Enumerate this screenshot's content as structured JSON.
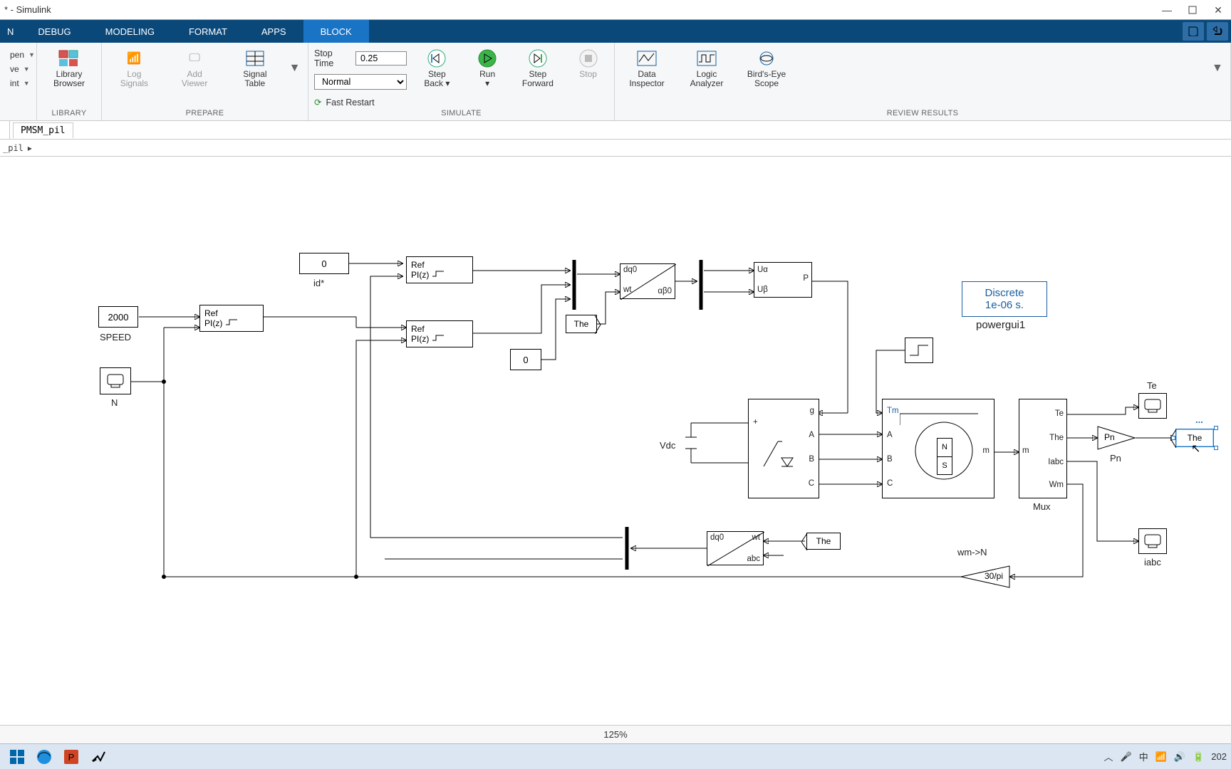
{
  "window": {
    "title": "* - Simulink",
    "min": "—",
    "max": "",
    "close": ""
  },
  "tabs": {
    "n": "N",
    "debug": "DEBUG",
    "modeling": "MODELING",
    "format": "FORMAT",
    "apps": "APPS",
    "block": "BLOCK"
  },
  "ribbon": {
    "file": {
      "open": "pen",
      "save": "ve",
      "print": "int"
    },
    "library": {
      "btn1": "Library",
      "btn2": "Browser",
      "group": "LIBRARY"
    },
    "prepare": {
      "log": "Log",
      "logs2": "Signals",
      "add": "Add",
      "add2": "Viewer",
      "sigtab": "Signal",
      "sigtab2": "Table",
      "group": "PREPARE"
    },
    "sim": {
      "stoptime_label": "Stop Time",
      "stoptime_value": "0.25",
      "mode": "Normal",
      "fast": "Fast Restart",
      "stepback": "Step",
      "stepback2": "Back",
      "run": "Run",
      "stepfwd": "Step",
      "stepfwd2": "Forward",
      "stop": "Stop",
      "group": "SIMULATE"
    },
    "review": {
      "di": "Data",
      "di2": "Inspector",
      "la": "Logic",
      "la2": "Analyzer",
      "be": "Bird's-Eye",
      "be2": "Scope",
      "group": "REVIEW RESULTS"
    }
  },
  "model": {
    "tab": "PMSM_pil",
    "crumb": "_pil"
  },
  "blocks": {
    "speed_val": "2000",
    "speed_lbl": "SPEED",
    "idref_val": "0",
    "idref_lbl": "id*",
    "zero_val": "0",
    "scopeN_lbl": "N",
    "pi_ref": "Ref",
    "pi_piz": "PI(z)",
    "dq0": "dq0",
    "ab0": "αβ0",
    "wt": "wt",
    "the_tag": "The",
    "ua": "Uα",
    "ub": "Uβ",
    "pport": "P",
    "vdc": "Vdc",
    "inv_g": "g",
    "inv_A": "A",
    "inv_B": "B",
    "inv_C": "C",
    "inv_plus": "+",
    "pmsm_Tm": "Tm",
    "pmsm_A": "A",
    "pmsm_B": "B",
    "pmsm_C": "C",
    "pmsm_m": "m",
    "pmsm_N": "N",
    "pmsm_S": "S",
    "mux_Te": "Te",
    "mux_The": "The",
    "mux_iabc": "Iabc",
    "mux_Wm": "Wm",
    "mux_m": "m",
    "mux_lbl": "Mux",
    "powergui1": "Discrete",
    "powergui2": "1e-06 s.",
    "powergui_lbl": "powergui1",
    "te_lbl": "Te",
    "pn_gain": "Pn",
    "pn_lbl": "Pn",
    "the_goto": "The",
    "iabc_lbl": "iabc",
    "abc_dq0": "dq0",
    "abc_abc": "abc",
    "abc_wt": "wt",
    "the_from2": "The",
    "wmN": "wm->N",
    "gain30pi": "30/pi",
    "ellipsis": "..."
  },
  "status": {
    "zoom": "125%"
  },
  "taskbar": {
    "ime": "中",
    "year": "202"
  }
}
